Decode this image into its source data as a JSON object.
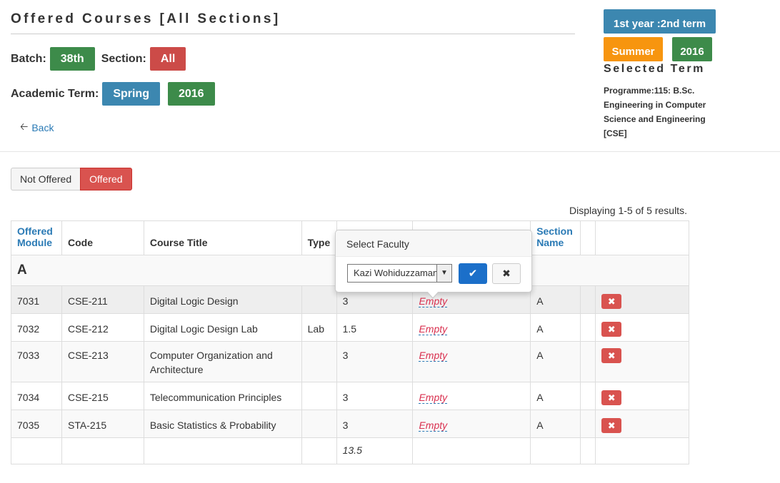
{
  "header": {
    "title": "Offered Courses [All Sections]",
    "batch_label": "Batch:",
    "batch_value": "38th",
    "section_label": "Section:",
    "section_value": "All",
    "term_label": "Academic Term:",
    "term_season": "Spring",
    "term_year": "2016",
    "back_label": "Back"
  },
  "selected_term": {
    "year_term": "1st year :2nd term",
    "season": "Summer",
    "year": "2016",
    "caption": "Selected Term",
    "programme": "Programme:115: B.Sc. Engineering in Computer Science and Engineering [CSE]"
  },
  "toggle": {
    "not_offered": "Not Offered",
    "offered": "Offered",
    "active": "Offered"
  },
  "summary": "Displaying 1-5 of 5 results.",
  "table": {
    "columns": [
      "Offered Module",
      "Code",
      "Course Title",
      "Type",
      "",
      "",
      "Section Name",
      "",
      ""
    ],
    "group": "A",
    "rows": [
      {
        "module": "7031",
        "code": "CSE-211",
        "title": "Digital Logic Design",
        "type": "",
        "credit": "3",
        "faculty": "Empty",
        "section": "A"
      },
      {
        "module": "7032",
        "code": "CSE-212",
        "title": "Digital Logic Design Lab",
        "type": "Lab",
        "credit": "1.5",
        "faculty": "Empty",
        "section": "A"
      },
      {
        "module": "7033",
        "code": "CSE-213",
        "title": "Computer Organization and Architecture",
        "type": "",
        "credit": "3",
        "faculty": "Empty",
        "section": "A"
      },
      {
        "module": "7034",
        "code": "CSE-215",
        "title": "Telecommunication Principles",
        "type": "",
        "credit": "3",
        "faculty": "Empty",
        "section": "A"
      },
      {
        "module": "7035",
        "code": "STA-215",
        "title": "Basic Statistics & Probability",
        "type": "",
        "credit": "3",
        "faculty": "Empty",
        "section": "A"
      }
    ],
    "total_credit": "13.5"
  },
  "popover": {
    "title": "Select Faculty",
    "selected": "Kazi Wohiduzzaman"
  },
  "colors": {
    "green": "#3d8b4a",
    "red": "#cc4b48",
    "blue": "#3c87b0",
    "orange": "#f7950f",
    "link": "#2a7ab5",
    "danger": "#d9534f",
    "primary": "#1b6fc9"
  },
  "icons": {
    "back": "arrow-left-icon",
    "ok": "check-icon",
    "cancel": "times-icon",
    "delete": "times-icon"
  }
}
